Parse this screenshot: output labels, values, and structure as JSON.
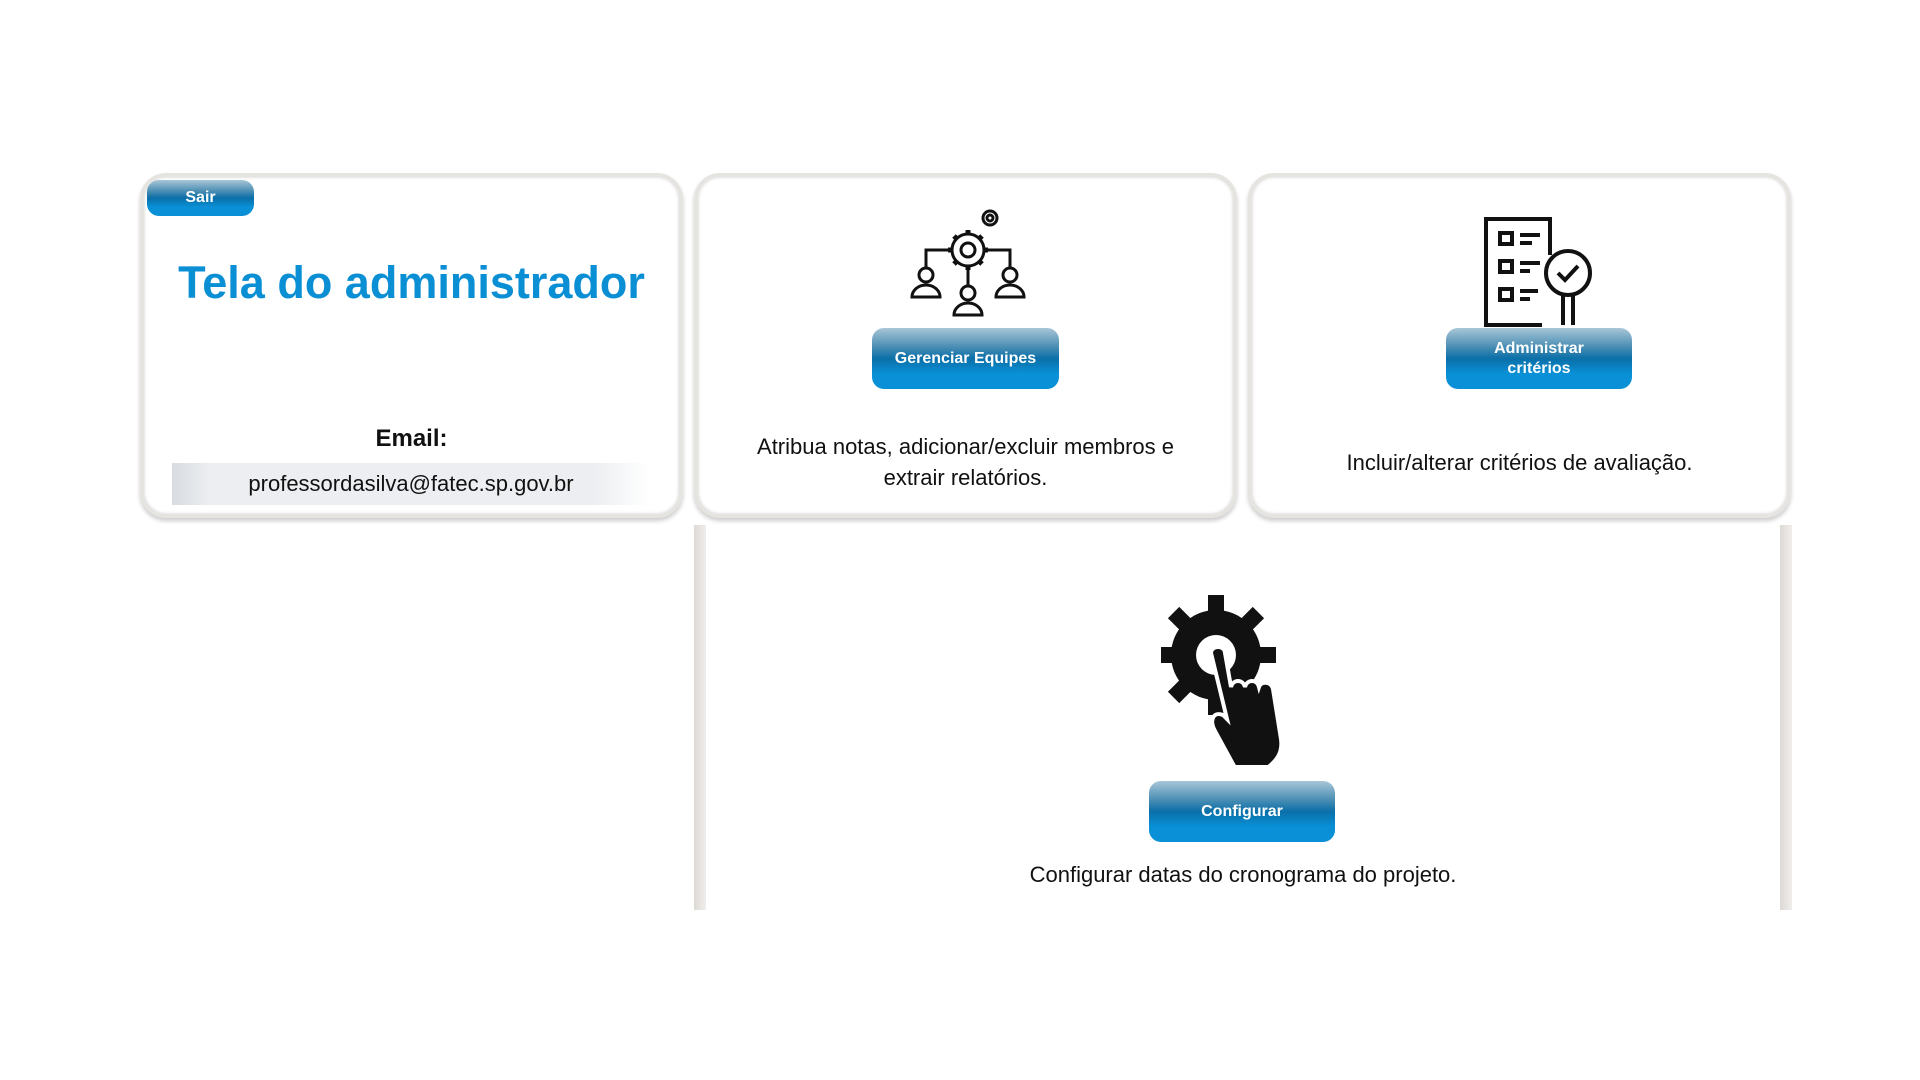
{
  "profile": {
    "logout_label": "Sair",
    "title": "Tela do administrador",
    "email_label": "Email:",
    "email_value": "professordasilva@fatec.sp.gov.br"
  },
  "teams": {
    "button_label": "Gerenciar Equipes",
    "description": "Atribua notas, adicionar/excluir membros e extrair relatórios.",
    "icon": "team-management-icon"
  },
  "criteria": {
    "button_label": "Administrar critérios",
    "description": "Incluir/alterar critérios de avaliação.",
    "icon": "checklist-icon"
  },
  "config": {
    "button_label": "Configurar",
    "description": "Configurar datas do cronograma do projeto.",
    "icon": "gear-hand-icon"
  },
  "colors": {
    "accent": "#0a8fd4",
    "border": "#e6e4e1"
  }
}
